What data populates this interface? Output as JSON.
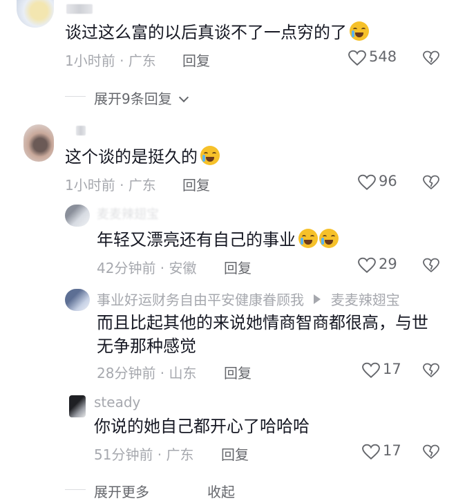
{
  "comments": [
    {
      "text": "谈过这么富的以后真谈不了一点穷的了",
      "time_location": "1小时前 · 广东",
      "reply_label": "回复",
      "likes": "548",
      "expand_label": "展开9条回复"
    },
    {
      "text": "这个谈的是挺久的",
      "time_location": "1小时前 · 广东",
      "reply_label": "回复",
      "likes": "96",
      "replies": [
        {
          "username": "麦麦辣翅宝",
          "text": "年轻又漂亮还有自己的事业",
          "time_location": "42分钟前 · 安徽",
          "reply_label": "回复",
          "likes": "29"
        },
        {
          "username": "事业好运财务自由平安健康眷顾我",
          "reply_to": "麦麦辣翅宝",
          "text": "而且比起其他的来说她情商智商都很高，与世无争那种感觉",
          "time_location": "28分钟前 · 山东",
          "reply_label": "回复",
          "likes": "17"
        },
        {
          "username": "steady",
          "text": "你说的她自己都开心了哈哈哈",
          "time_location": "51分钟前 · 广东",
          "reply_label": "回复",
          "likes": "17"
        }
      ],
      "expand_more_label": "展开更多",
      "collapse_label": "收起"
    }
  ],
  "colors": {
    "text": "#161823",
    "meta": "#a6a8ae",
    "action": "#65676c"
  }
}
